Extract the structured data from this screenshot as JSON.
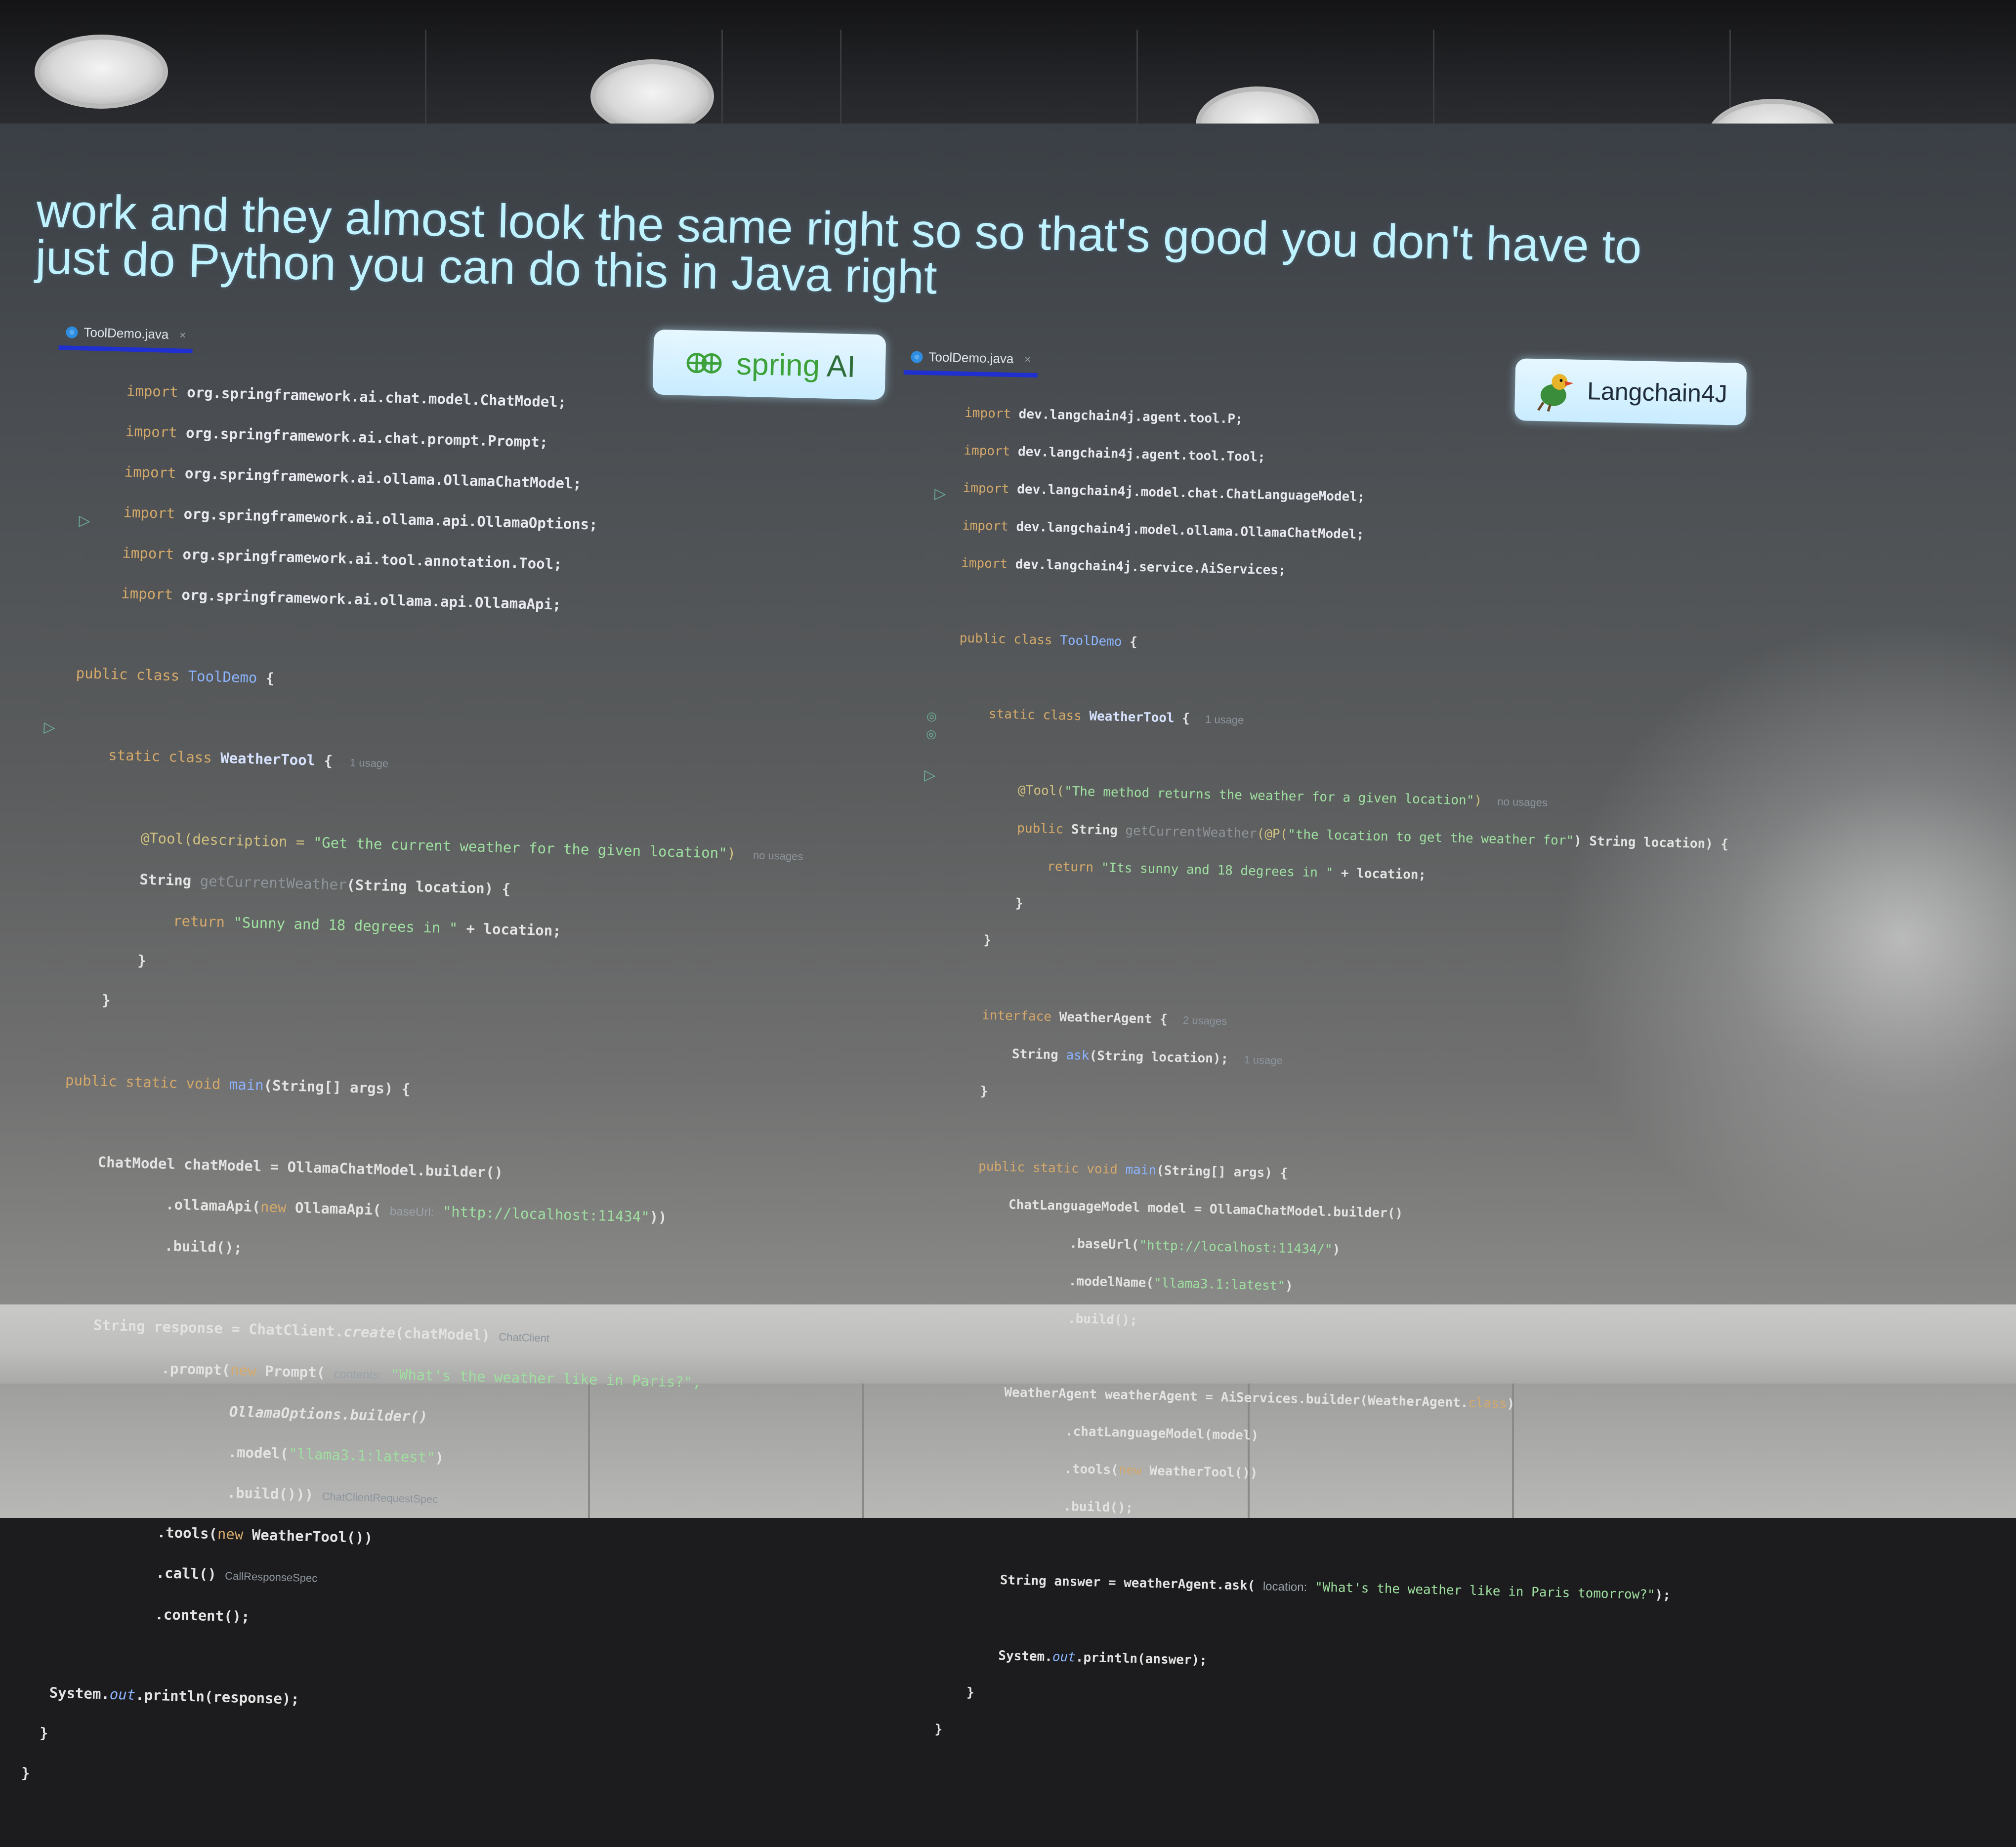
{
  "caption": {
    "line1": "work and they almost look the same right so so that's good you don't have to",
    "line2": "just do Python you can do this in Java right"
  },
  "badges": {
    "spring": {
      "label_prefix": "spring",
      "label_suffix": "AI",
      "icon": "spring-leaf-icon",
      "text_color": "#3da13a"
    },
    "langchain": {
      "label": "Langchain4J",
      "icon": "parrot-chain-icon"
    }
  },
  "left_panel": {
    "tab": {
      "label": "ToolDemo.java",
      "close": "×"
    },
    "imports": [
      "org.springframework.ai.chat.model.ChatModel;",
      "org.springframework.ai.chat.prompt.Prompt;",
      "org.springframework.ai.ollama.OllamaChatModel;",
      "org.springframework.ai.ollama.api.OllamaOptions;",
      "org.springframework.ai.tool.annotation.Tool;",
      "org.springframework.ai.ollama.api.OllamaApi;"
    ],
    "import_kw": "import",
    "class_decl": {
      "kw": "public class",
      "name": "ToolDemo",
      "brace": "{"
    },
    "inner_class": {
      "kw": "static class",
      "name": "WeatherTool",
      "brace": "{",
      "hint": "1 usage"
    },
    "tool_annotation": {
      "ann": "@Tool(description = ",
      "str": "\"Get the current weather for the given location\"",
      "close": ")",
      "hint": "no usages"
    },
    "method_sig": {
      "ret": "String",
      "name": "getCurrentWeather",
      "args": "(String location) {"
    },
    "return_line": {
      "kw": "return",
      "str": "\"Sunny and 18 degrees in \"",
      "rest": " + location;"
    },
    "close_inner1": "}",
    "close_inner2": "}",
    "main_sig": {
      "kw": "public static void",
      "name": "main",
      "args": "(String[] args) {"
    },
    "chat_model": [
      "ChatModel chatModel = OllamaChatModel.builder()",
      ".ollamaApi(",
      "new",
      " OllamaApi(",
      "baseUrl:",
      "\"http://localhost:11434\"",
      "))",
      ".build();"
    ],
    "response": {
      "decl": "String response = ChatClient.",
      "create": "create",
      "arg": "(chatModel)",
      "hint1": "ChatClient",
      "prompt": ".prompt(",
      "new": "new",
      "prompt_cls": " Prompt(",
      "contents": "contents:",
      "contents_str": "\"What's the weather like in Paris?\",",
      "options": "OllamaOptions.builder()",
      "model_call": ".model(",
      "model_str": "\"llama3.1:latest\"",
      "model_close": ")",
      "build": ".build()))",
      "hint2": "ChatClientRequestSpec",
      "tools": ".tools(",
      "tools_new": "new",
      "tools_cls": " WeatherTool())",
      "call": ".call()",
      "hint3": "CallResponseSpec",
      "content": ".content();"
    },
    "println": {
      "pre": "System.",
      "out": "out",
      "post": ".println(response);"
    },
    "close_main": "}",
    "close_class": "}"
  },
  "right_panel": {
    "tab": {
      "label": "ToolDemo.java",
      "close": "×"
    },
    "import_kw": "import",
    "imports": [
      "dev.langchain4j.agent.tool.P;",
      "dev.langchain4j.agent.tool.Tool;",
      "dev.langchain4j.model.chat.ChatLanguageModel;",
      "dev.langchain4j.model.ollama.OllamaChatModel;",
      "dev.langchain4j.service.AiServices;"
    ],
    "class_decl": {
      "kw": "public class",
      "name": "ToolDemo",
      "brace": "{"
    },
    "inner_class": {
      "kw": "static class",
      "name": "WeatherTool",
      "brace": "{",
      "hint": "1 usage"
    },
    "tool_annotation": {
      "ann": "@Tool(",
      "str": "\"The method returns the weather for a given location\"",
      "close": ")",
      "hint": "no usages"
    },
    "method_sig": {
      "kw": "public",
      "ret": " String ",
      "name": "getCurrentWeather",
      "p_ann": "(@P(",
      "p_str": "\"the location to get the weather for\"",
      "rest": ") String location) {"
    },
    "return_line": {
      "kw": "return",
      "str": "\"Its sunny and 18 degrees in \"",
      "rest": " + location;"
    },
    "close_inner1": "}",
    "close_inner2": "}",
    "interface": {
      "kw": "interface",
      "name": " WeatherAgent {",
      "hint": "2 usages"
    },
    "ask": {
      "ret": "String ",
      "name": "ask",
      "args": "(String location);",
      "hint": "1 usage"
    },
    "close_iface": "}",
    "main_sig": {
      "kw": "public static void",
      "name": "main",
      "args": "(String[] args) {"
    },
    "model_decl": "ChatLanguageModel model = OllamaChatModel.builder()",
    "base_url": {
      "call": ".baseUrl(",
      "str": "\"http://localhost:11434/\"",
      "close": ")"
    },
    "model_name": {
      "call": ".modelName(",
      "str": "\"llama3.1:latest\"",
      "close": ")"
    },
    "build1": ".build();",
    "agent_decl": {
      "pre": "WeatherAgent weatherAgent = AiServices.builder(WeatherAgent.",
      "kw": "class",
      "close": ")"
    },
    "chat_lm": ".chatLanguageModel(model)",
    "tools": {
      "call": ".tools(",
      "kw": "new",
      "rest": " WeatherTool())"
    },
    "build2": ".build();",
    "answer": {
      "pre": "String answer = weatherAgent.ask(",
      "param": "location:",
      "str": "\"What's the weather like in Paris tomorrow?\"",
      "close": ");"
    },
    "println": {
      "pre": "System.",
      "out": "out",
      "post": ".println(answer);"
    },
    "close_main": "}",
    "close_class": "}"
  }
}
